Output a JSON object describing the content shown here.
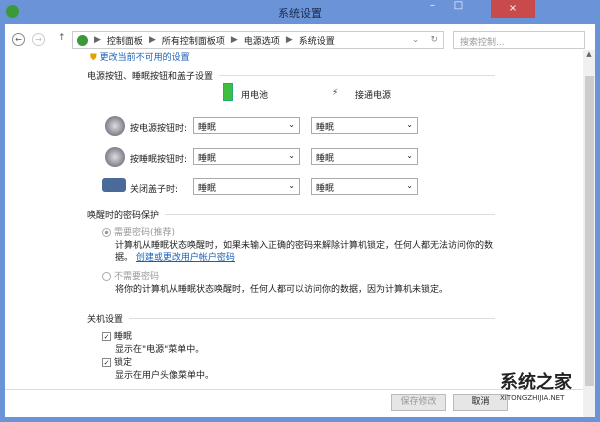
{
  "window": {
    "title": "系统设置",
    "close": "×",
    "min": "–",
    "max": "□"
  },
  "nav": {
    "back": "←",
    "forward": "→",
    "up": "↑",
    "breadcrumb": [
      "控制面板",
      "所有控制面板项",
      "电源选项",
      "系统设置"
    ],
    "search_placeholder": "搜索控制...",
    "refresh": "↻"
  },
  "admin_link": "更改当前不可用的设置",
  "power": {
    "heading": "电源按钮、睡眠按钮和盖子设置",
    "battery": "用电池",
    "plugged": "接通电源",
    "rows": [
      {
        "label": "按电源按钮时:",
        "battery": "睡眠",
        "plugged": "睡眠"
      },
      {
        "label": "按睡眠按钮时:",
        "battery": "睡眠",
        "plugged": "睡眠"
      },
      {
        "label": "关闭盖子时:",
        "battery": "睡眠",
        "plugged": "睡眠"
      }
    ]
  },
  "password": {
    "heading": "唤醒时的密码保护",
    "require_label": "需要密码(推荐)",
    "require_desc": "计算机从睡眠状态唤醒时，如果未输入正确的密码来解除计算机锁定，任何人都无法访问你的数",
    "require_desc2": "据。",
    "account_link": "创建或更改用户帐户密码",
    "none_label": "不需要密码",
    "none_desc": "将你的计算机从睡眠状态唤醒时，任何人都可以访问你的数据，因为计算机未锁定。"
  },
  "shutdown": {
    "heading": "关机设置",
    "sleep": "睡眠",
    "sleep_desc": "显示在\"电源\"菜单中。",
    "lock": "锁定",
    "lock_desc": "显示在用户头像菜单中。"
  },
  "buttons": {
    "save": "保存修改",
    "cancel": "取消"
  },
  "watermark": {
    "name": "系统之家",
    "url": "XITONGZHIJIA.NET"
  }
}
